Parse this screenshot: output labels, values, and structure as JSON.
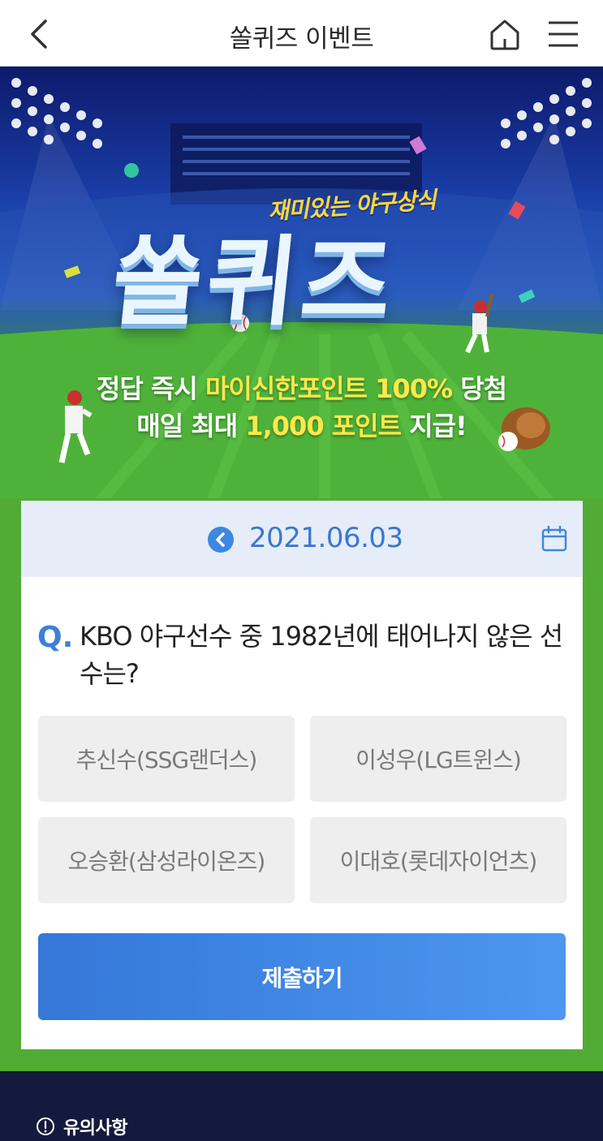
{
  "header": {
    "title": "쏠퀴즈 이벤트",
    "back_icon": "chevron-left-icon",
    "home_icon": "home-icon",
    "menu_icon": "hamburger-menu-icon"
  },
  "banner": {
    "subtitle": "재미있는 야구상식",
    "logo_text": "쏠퀴즈",
    "line1_prefix": "정답 즉시 ",
    "line1_highlight": "마이신한포인트 100%",
    "line1_suffix": " 당첨",
    "line2_prefix": "매일 최대 ",
    "line2_highlight": "1,000 포인트",
    "line2_suffix": " 지급!",
    "highlight_color": "#ffe84a"
  },
  "quiz": {
    "date": "2021.06.03",
    "question_marker": "Q.",
    "question": "KBO 야구선수 중 1982년에 태어나지 않은 선수는?",
    "options": [
      "추신수(SSG랜더스)",
      "이성우(LG트윈스)",
      "오승환(삼성라이온즈)",
      "이대호(롯데자이언츠)"
    ],
    "submit_label": "제출하기",
    "accent_color": "#3d87e0"
  },
  "footer": {
    "notice_label": "유의사항",
    "notice_icon": "info-circle-icon"
  }
}
